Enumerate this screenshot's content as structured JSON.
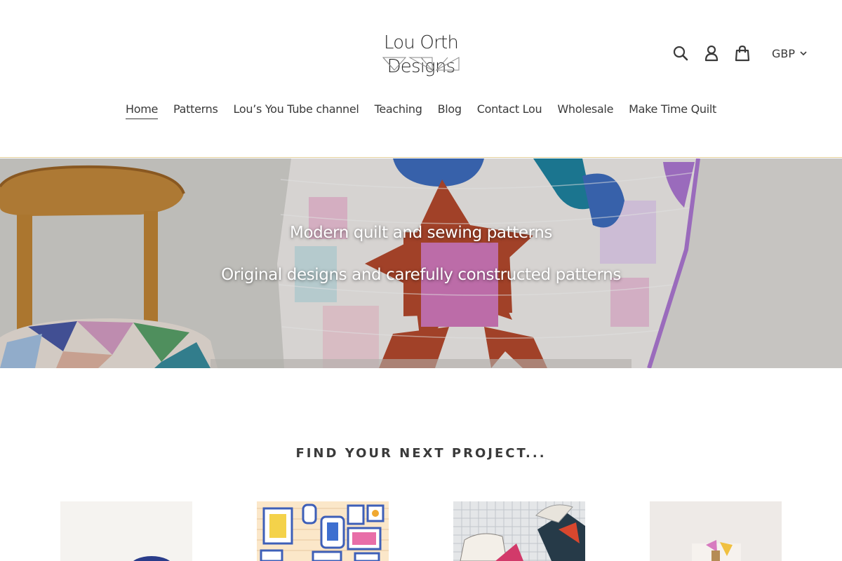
{
  "brand": {
    "name": "Lou Orth Designs"
  },
  "header": {
    "icons": [
      "search-icon",
      "account-icon",
      "cart-icon"
    ],
    "currency": "GBP"
  },
  "nav": {
    "items": [
      {
        "label": "Home",
        "active": true
      },
      {
        "label": "Patterns"
      },
      {
        "label": "Lou’s You Tube channel"
      },
      {
        "label": "Teaching"
      },
      {
        "label": "Blog"
      },
      {
        "label": "Contact Lou"
      },
      {
        "label": "Wholesale"
      },
      {
        "label": "Make Time Quilt"
      }
    ]
  },
  "hero": {
    "title": "Modern quilt and sewing patterns",
    "subtitle": "Original designs and carefully constructed patterns"
  },
  "collection": {
    "title": "FIND YOUR NEXT PROJECT..."
  },
  "colors": {
    "text": "#3a3a3a",
    "header_border": "#e3cf9a",
    "quilt_red": "#b84a2e",
    "quilt_pink": "#d77bc0",
    "quilt_blue": "#3f6fc2",
    "quilt_teal": "#1f86a3"
  }
}
